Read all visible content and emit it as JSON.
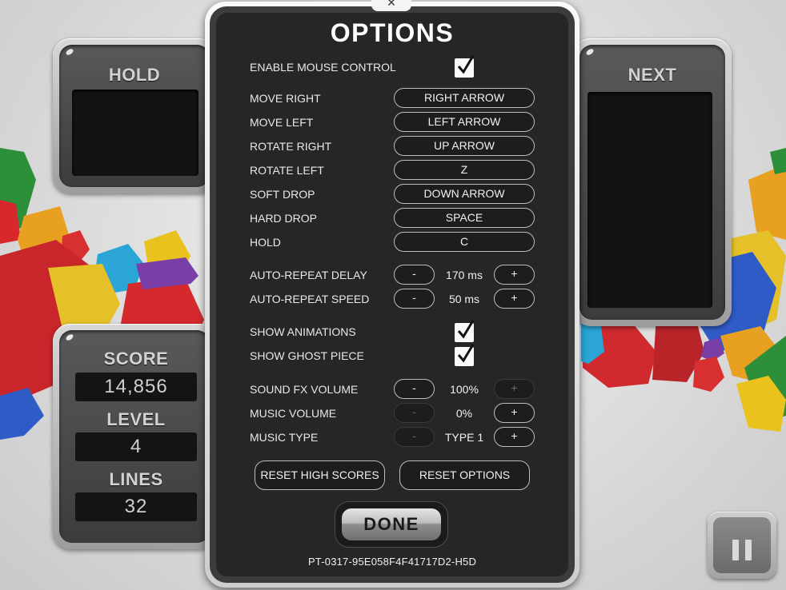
{
  "dialog": {
    "title": "OPTIONS",
    "close_symbol": "✕",
    "enable_mouse_label": "ENABLE MOUSE CONTROL",
    "enable_mouse_checked": true,
    "keybindings": [
      {
        "action": "MOVE RIGHT",
        "key": "RIGHT ARROW"
      },
      {
        "action": "MOVE LEFT",
        "key": "LEFT ARROW"
      },
      {
        "action": "ROTATE RIGHT",
        "key": "UP ARROW"
      },
      {
        "action": "ROTATE LEFT",
        "key": "Z"
      },
      {
        "action": "SOFT DROP",
        "key": "DOWN ARROW"
      },
      {
        "action": "HARD DROP",
        "key": "SPACE"
      },
      {
        "action": "HOLD",
        "key": "C"
      }
    ],
    "auto_repeat_delay": {
      "label": "AUTO-REPEAT DELAY",
      "value": "170 ms"
    },
    "auto_repeat_speed": {
      "label": "AUTO-REPEAT SPEED",
      "value": "50 ms"
    },
    "show_animations": {
      "label": "SHOW ANIMATIONS",
      "checked": true
    },
    "show_ghost_piece": {
      "label": "SHOW GHOST PIECE",
      "checked": true
    },
    "sound_fx_volume": {
      "label": "SOUND FX VOLUME",
      "value": "100%"
    },
    "music_volume": {
      "label": "MUSIC VOLUME",
      "value": "0%"
    },
    "music_type": {
      "label": "MUSIC TYPE",
      "value": "TYPE 1"
    },
    "minus_label": "-",
    "plus_label": "+",
    "reset_high_scores_label": "RESET HIGH SCORES",
    "reset_options_label": "RESET OPTIONS",
    "done_label": "DONE",
    "version": "PT-0317-95E058F4F41717D2-H5D"
  },
  "hold_panel": {
    "title": "HOLD"
  },
  "next_panel": {
    "title": "NEXT"
  },
  "stats": {
    "score_label": "SCORE",
    "score": "14,856",
    "level_label": "LEVEL",
    "level": "4",
    "lines_label": "LINES",
    "lines": "32"
  },
  "pause_icon": "pause-icon"
}
